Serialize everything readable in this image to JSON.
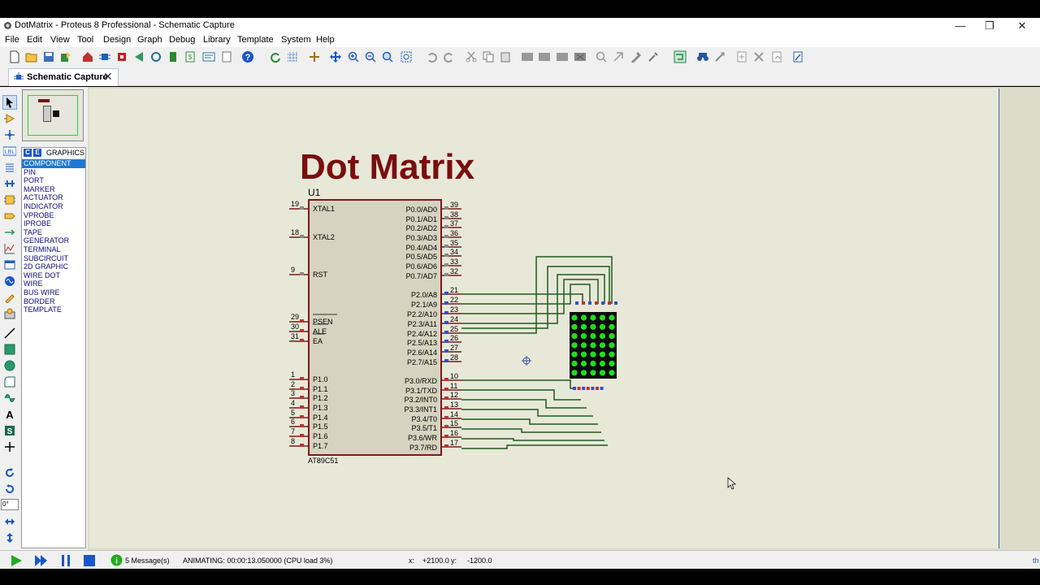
{
  "window": {
    "title": "DotMatrix - Proteus 8 Professional - Schematic Capture",
    "minimize": "—",
    "restore": "❐",
    "close": "✕"
  },
  "menu": [
    "File",
    "Edit",
    "View",
    "Tool",
    "Design",
    "Graph",
    "Debug",
    "Library",
    "Template",
    "System",
    "Help"
  ],
  "tab": {
    "label": "Schematic Capture",
    "close": "✕"
  },
  "selector": {
    "header_c": "C",
    "header_e": "E",
    "header_label": "GRAPHICS",
    "items": [
      "COMPONENT",
      "PIN",
      "PORT",
      "MARKER",
      "ACTUATOR",
      "INDICATOR",
      "VPROBE",
      "IPROBE",
      "TAPE",
      "GENERATOR",
      "TERMINAL",
      "SUBCIRCUIT",
      "2D GRAPHIC",
      "WIRE DOT",
      "WIRE",
      "BUS WIRE",
      "BORDER",
      "TEMPLATE"
    ],
    "selected": "COMPONENT",
    "rotation_value": "0°"
  },
  "schematic": {
    "title": "Dot Matrix",
    "ref": "U1",
    "part": "AT89C51",
    "left_pins": [
      {
        "num": "19",
        "name": "XTAL1"
      },
      {
        "num": "18",
        "name": "XTAL2"
      },
      {
        "num": "9",
        "name": "RST"
      },
      {
        "num": "29",
        "name": "PSEN"
      },
      {
        "num": "30",
        "name": "ALE"
      },
      {
        "num": "31",
        "name": "EA"
      },
      {
        "num": "1",
        "name": "P1.0"
      },
      {
        "num": "2",
        "name": "P1.1"
      },
      {
        "num": "3",
        "name": "P1.2"
      },
      {
        "num": "4",
        "name": "P1.3"
      },
      {
        "num": "5",
        "name": "P1.4"
      },
      {
        "num": "6",
        "name": "P1.5"
      },
      {
        "num": "7",
        "name": "P1.6"
      },
      {
        "num": "8",
        "name": "P1.7"
      }
    ],
    "right_pins": [
      {
        "num": "39",
        "name": "P0.0/AD0"
      },
      {
        "num": "38",
        "name": "P0.1/AD1"
      },
      {
        "num": "37",
        "name": "P0.2/AD2"
      },
      {
        "num": "36",
        "name": "P0.3/AD3"
      },
      {
        "num": "35",
        "name": "P0.4/AD4"
      },
      {
        "num": "34",
        "name": "P0.5/AD5"
      },
      {
        "num": "33",
        "name": "P0.6/AD6"
      },
      {
        "num": "32",
        "name": "P0.7/AD7"
      },
      {
        "num": "21",
        "name": "P2.0/A8"
      },
      {
        "num": "22",
        "name": "P2.1/A9"
      },
      {
        "num": "23",
        "name": "P2.2/A10"
      },
      {
        "num": "24",
        "name": "P2.3/A11"
      },
      {
        "num": "25",
        "name": "P2.4/A12"
      },
      {
        "num": "26",
        "name": "P2.5/A13"
      },
      {
        "num": "27",
        "name": "P2.6/A14"
      },
      {
        "num": "28",
        "name": "P2.7/A15"
      },
      {
        "num": "10",
        "name": "P3.0/RXD"
      },
      {
        "num": "11",
        "name": "P3.1/TXD"
      },
      {
        "num": "12",
        "name": "P3.2/INT0"
      },
      {
        "num": "13",
        "name": "P3.3/INT1"
      },
      {
        "num": "14",
        "name": "P3.4/T0"
      },
      {
        "num": "15",
        "name": "P3.5/T1"
      },
      {
        "num": "16",
        "name": "P3.6/WR"
      },
      {
        "num": "17",
        "name": "P3.7/RD"
      }
    ],
    "colors": {
      "title": "#7a0e0e",
      "chip_body": "#d6d3c0",
      "chip_border": "#7a1a1a",
      "wire": "#1e5a1e",
      "led_on": "#22dd22",
      "matrix_bg": "#0a0a0a"
    }
  },
  "status": {
    "messages": "5 Message(s)",
    "animating": "ANIMATING: 00:00:13.050000 (CPU load 3%)",
    "x_label": "x:",
    "x_value": "+2100.0",
    "y_label": "y:",
    "y_value": "-1200.0",
    "corner": "th"
  }
}
